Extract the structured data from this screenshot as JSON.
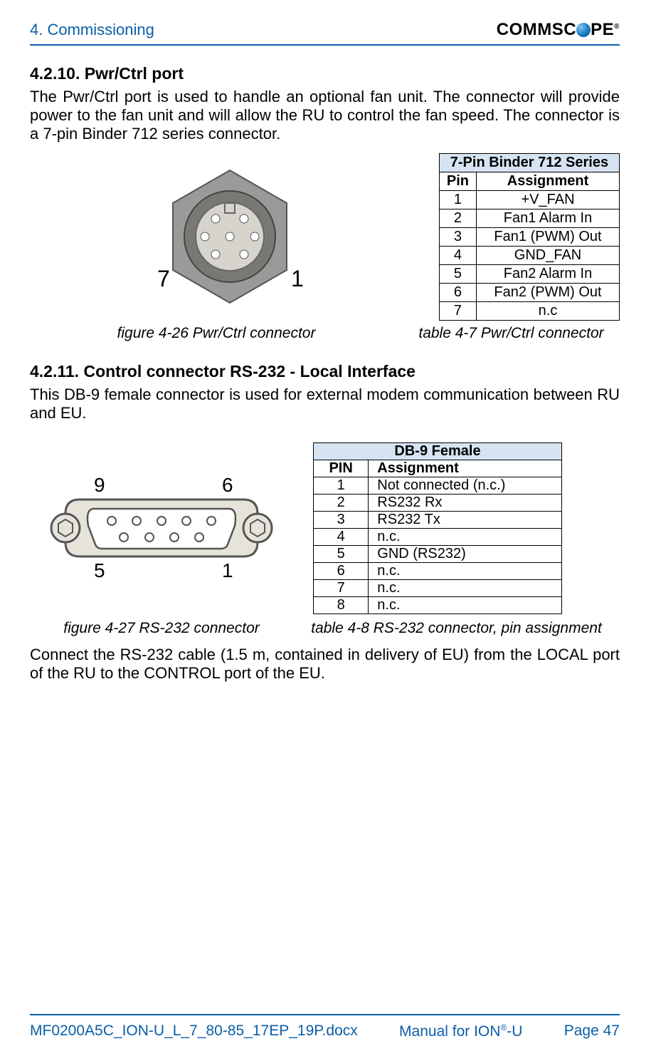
{
  "header": {
    "chapter": "4. Commissioning",
    "brand": "COMMSCOPE"
  },
  "section_a": {
    "title": "4.2.10. Pwr/Ctrl port",
    "paragraph": "The Pwr/Ctrl port is used to handle an optional fan unit. The connector will provide power to the fan unit and will allow the RU to control the fan speed. The connector is a 7-pin Binder 712 series connector.",
    "figure_caption": "figure 4-26 Pwr/Ctrl connector",
    "table_caption": "table 4-7 Pwr/Ctrl connector",
    "figure_labels": {
      "left": "7",
      "right": "1"
    }
  },
  "table_a": {
    "title": "7-Pin Binder 712 Series",
    "headers": {
      "pin": "Pin",
      "assignment": "Assignment"
    },
    "rows": [
      {
        "pin": "1",
        "assignment": "+V_FAN"
      },
      {
        "pin": "2",
        "assignment": "Fan1 Alarm In"
      },
      {
        "pin": "3",
        "assignment": "Fan1 (PWM) Out"
      },
      {
        "pin": "4",
        "assignment": "GND_FAN"
      },
      {
        "pin": "5",
        "assignment": "Fan2 Alarm In"
      },
      {
        "pin": "6",
        "assignment": "Fan2 (PWM) Out"
      },
      {
        "pin": "7",
        "assignment": "n.c"
      }
    ]
  },
  "section_b": {
    "title": "4.2.11. Control connector RS-232 - Local Interface",
    "paragraph": "This DB-9 female connector is used for external modem communication between RU and EU.",
    "figure_caption": "figure 4-27 RS-232 connector",
    "table_caption": "table 4-8 RS-232 connector, pin assignment",
    "figure_labels": {
      "tl": "9",
      "tr": "6",
      "bl": "5",
      "br": "1"
    },
    "closing": "Connect the RS-232 cable (1.5 m, contained in delivery of EU) from the LOCAL port of the RU to the CONTROL port of the EU."
  },
  "table_b": {
    "title": "DB-9 Female",
    "headers": {
      "pin": "PIN",
      "assignment": "Assignment"
    },
    "rows": [
      {
        "pin": "1",
        "assignment": "Not connected (n.c.)"
      },
      {
        "pin": "2",
        "assignment": "RS232 Rx"
      },
      {
        "pin": "3",
        "assignment": "RS232 Tx"
      },
      {
        "pin": "4",
        "assignment": "n.c."
      },
      {
        "pin": "5",
        "assignment": "GND (RS232)"
      },
      {
        "pin": "6",
        "assignment": "n.c."
      },
      {
        "pin": "7",
        "assignment": "n.c."
      },
      {
        "pin": "8",
        "assignment": "n.c."
      }
    ]
  },
  "footer": {
    "filename": "MF0200A5C_ION-U_L_7_80-85_17EP_19P.docx",
    "manual_pre": "Manual for ION",
    "manual_post": "-U",
    "page": "Page 47"
  }
}
